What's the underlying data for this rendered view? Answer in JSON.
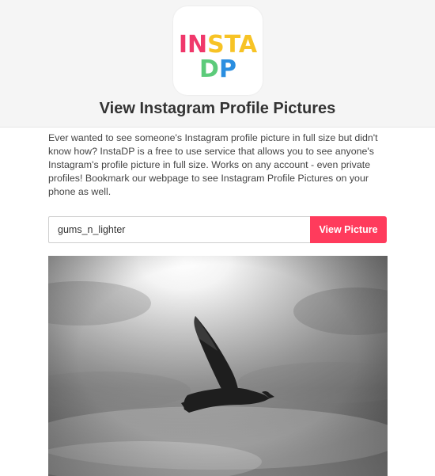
{
  "logo": {
    "line1": [
      {
        "text": "IN",
        "color": "#f0386b"
      },
      {
        "text": "STA",
        "color": "#f7c325"
      }
    ],
    "line2": [
      {
        "text": "D",
        "color": "#5ccb7a"
      },
      {
        "text": "P",
        "color": "#2a8ee0"
      }
    ]
  },
  "page_title": "View Instagram Profile Pictures",
  "description": "Ever wanted to see someone's Instagram profile picture in full size but didn't know how? InstaDP is a free to use service that allows you to see anyone's Instagram's profile picture in full size. Works on any account - even private profiles! Bookmark our webpage to see Instagram Profile Pictures on your phone as well.",
  "search": {
    "value": "gums_n_lighter"
  },
  "view_button_label": "View Picture",
  "colors": {
    "accent": "#ff3b5c",
    "header_bg": "#f5f5f5"
  }
}
